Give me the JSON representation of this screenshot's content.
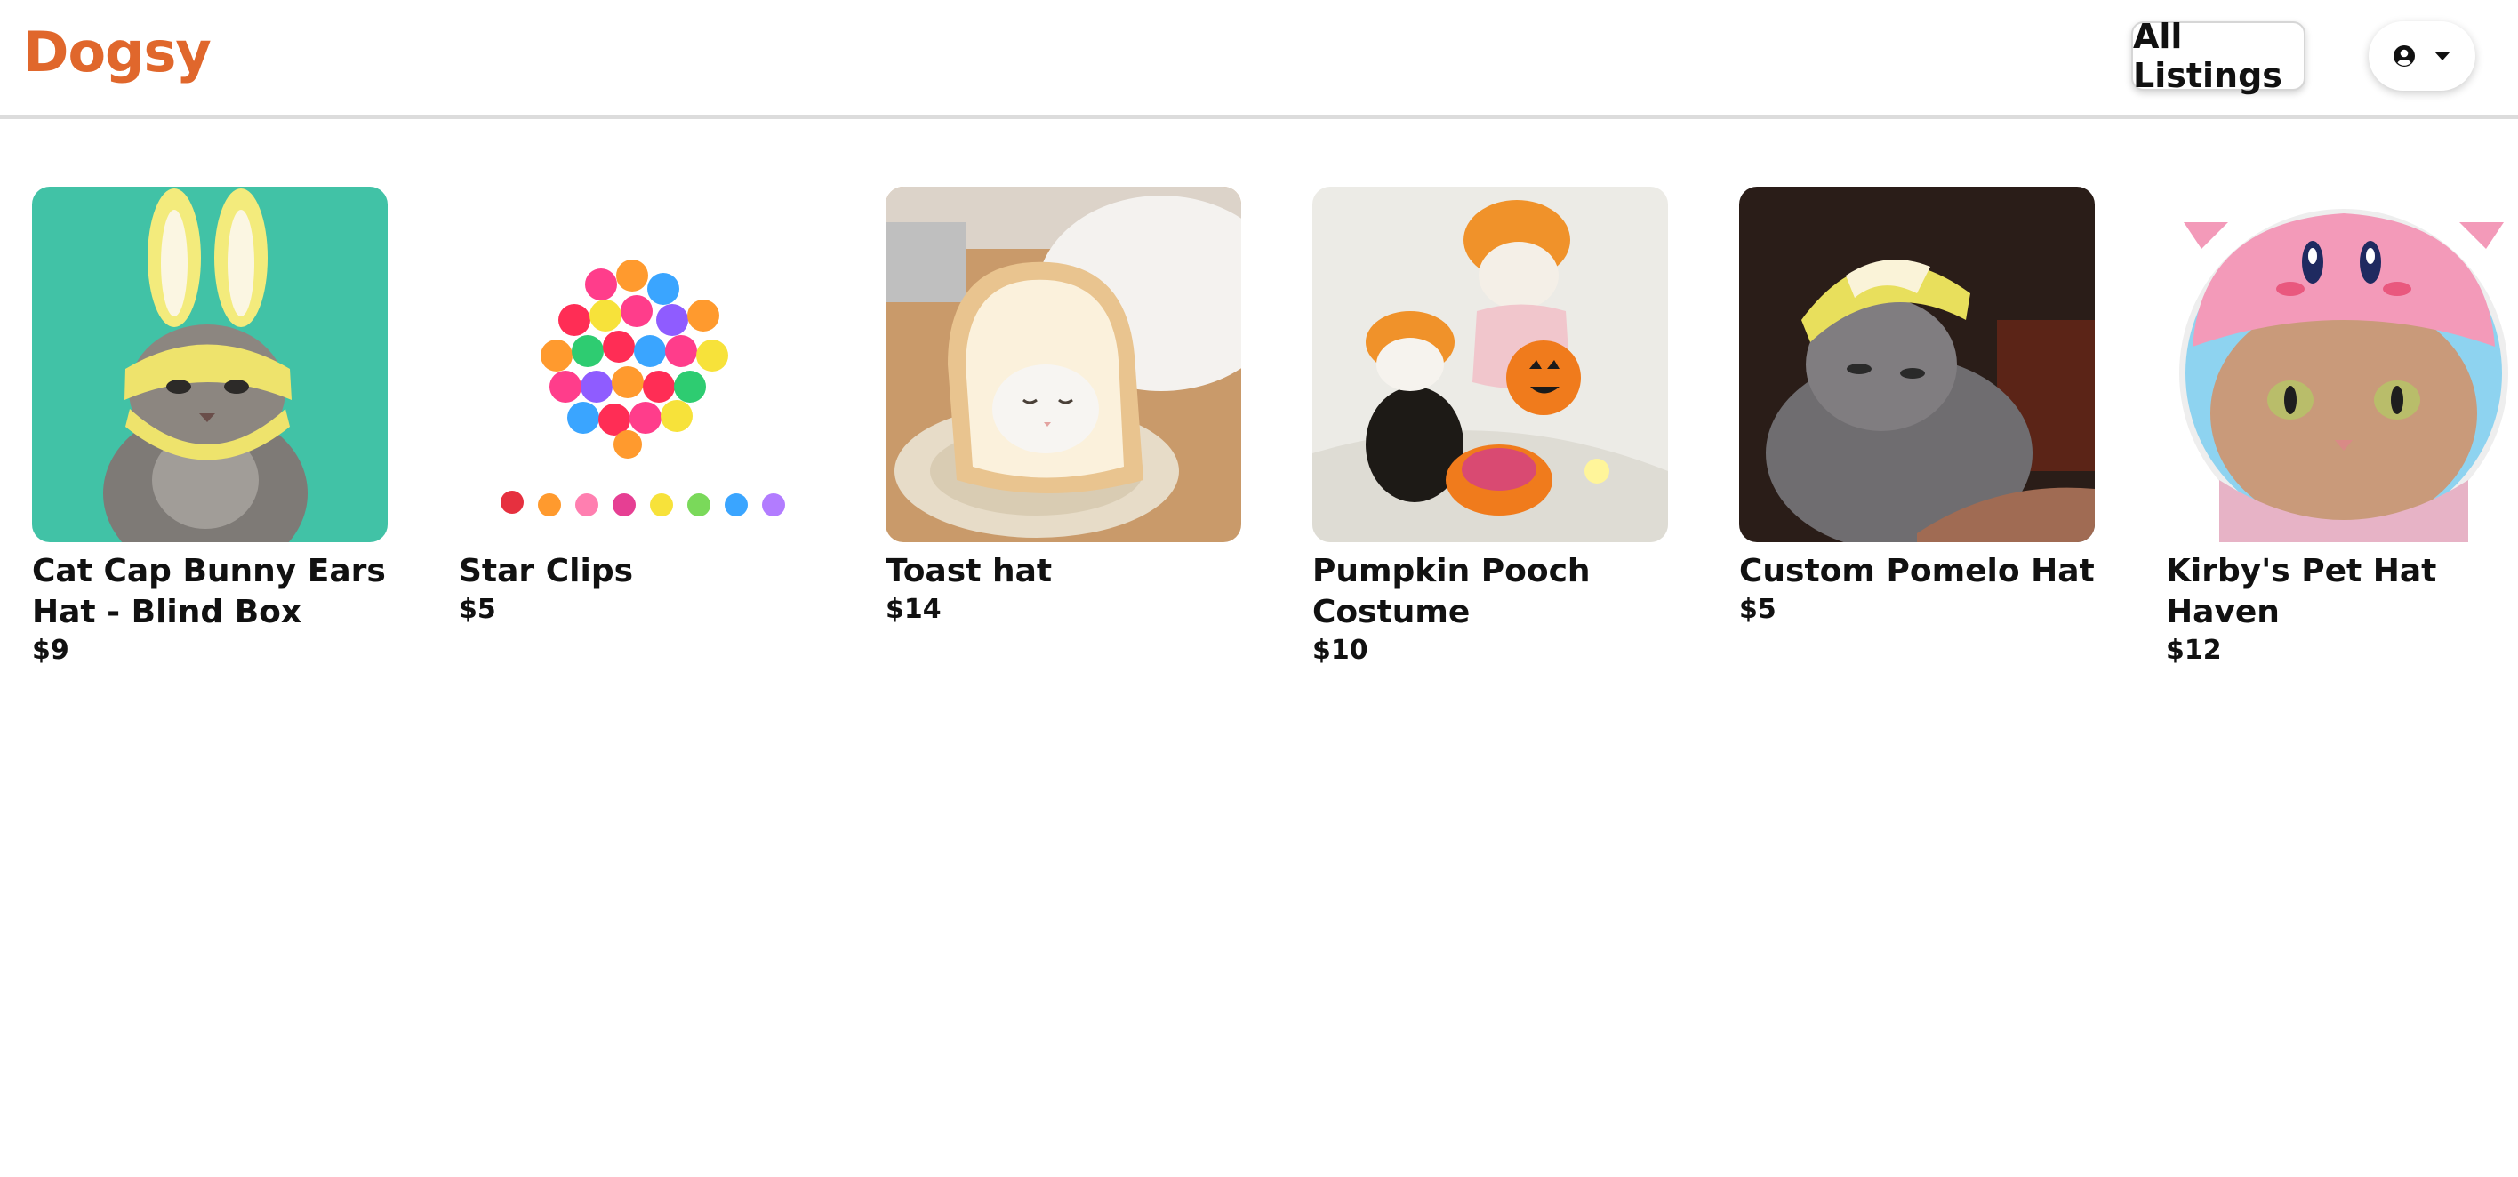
{
  "header": {
    "logo": "Dogsy",
    "nav_all_listings": "All Listings",
    "user_icon": "user-circle-icon",
    "caret_icon": "caret-down-icon"
  },
  "colors": {
    "brand": "#e0672c",
    "text": "#111111",
    "divider": "#dcdcdc"
  },
  "listings": [
    {
      "title": "Cat Cap Bunny Ears Hat - Blind Box",
      "price": "$9"
    },
    {
      "title": "Star Clips",
      "price": "$5"
    },
    {
      "title": "Toast hat",
      "price": "$14"
    },
    {
      "title": "Pumpkin Pooch Costume",
      "price": "$10"
    },
    {
      "title": "Custom Pomelo Hat",
      "price": "$5"
    },
    {
      "title": "Kirby's Pet Hat Haven",
      "price": "$12"
    }
  ]
}
